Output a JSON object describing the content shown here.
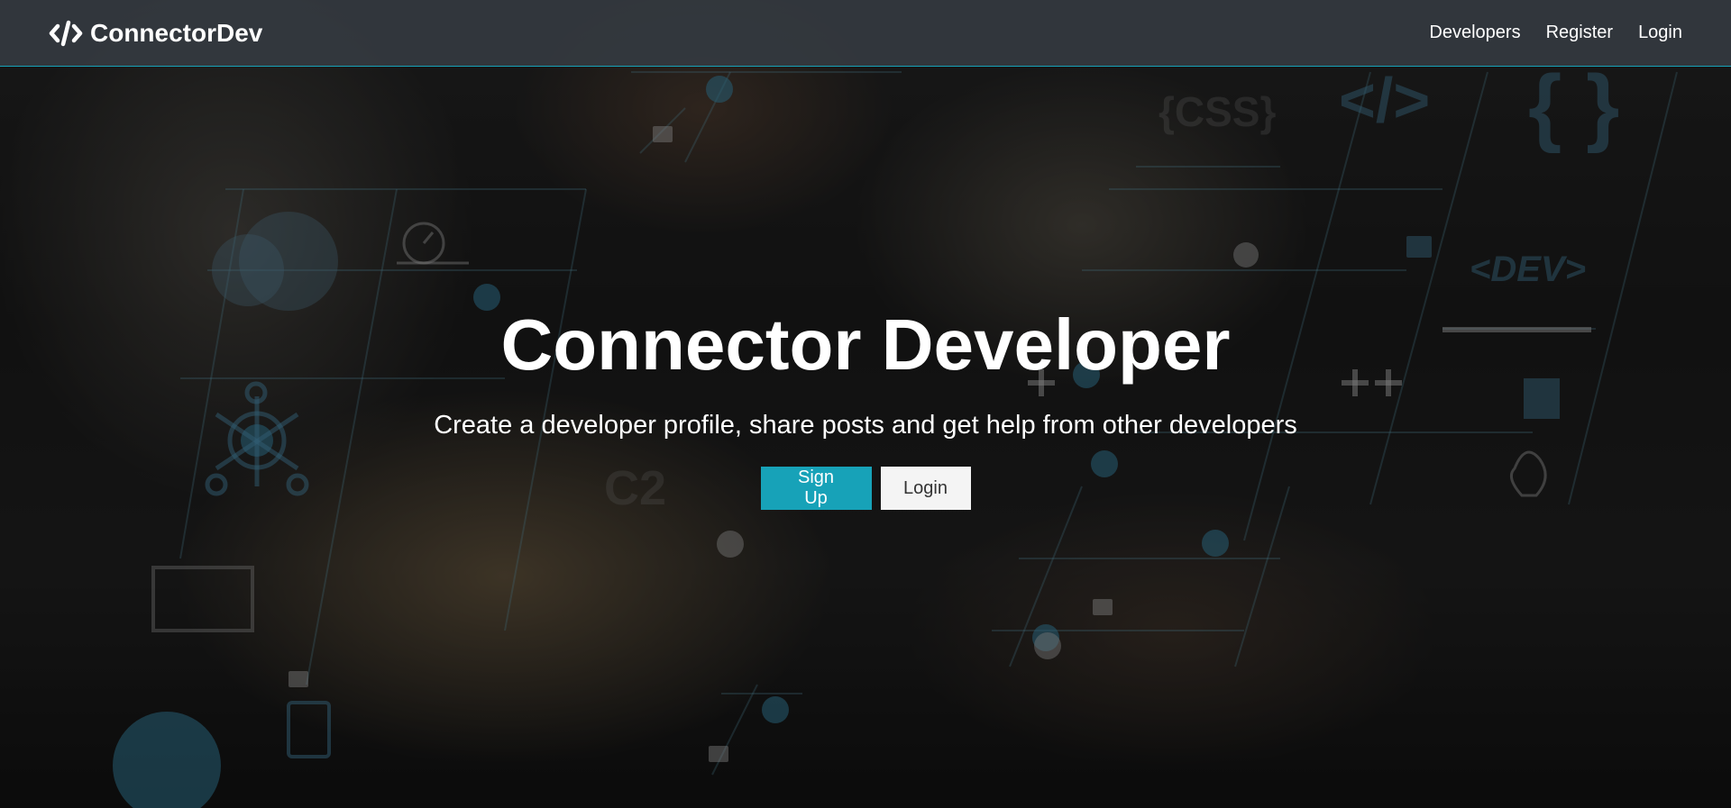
{
  "brand": {
    "name": "ConnectorDev",
    "icon": "code-icon"
  },
  "nav": {
    "items": [
      {
        "label": "Developers"
      },
      {
        "label": "Register"
      },
      {
        "label": "Login"
      }
    ]
  },
  "hero": {
    "title": "Connector Developer",
    "lead": "Create a developer profile, share posts and get help from other developers",
    "signup_label": "Sign Up",
    "login_label": "Login"
  },
  "colors": {
    "accent": "#17a2b8",
    "navbar": "#343a40",
    "light_button": "#f4f4f4"
  }
}
